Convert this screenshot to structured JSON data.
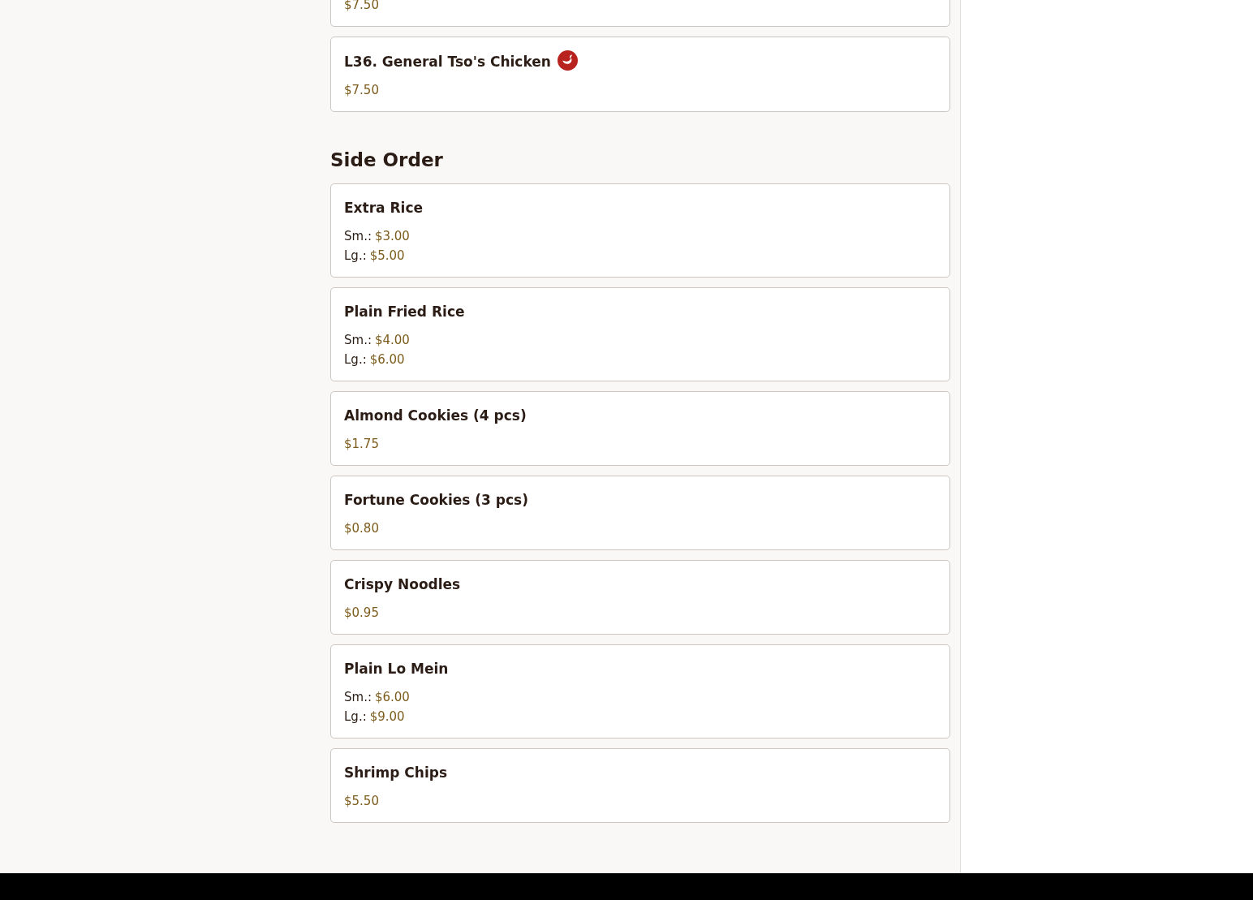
{
  "sections": [
    {
      "items": [
        {
          "kind": "single",
          "price": "$7.50"
        },
        {
          "kind": "single",
          "name": "L36. General Tso's Chicken",
          "price": "$7.50",
          "spicy": true
        }
      ]
    },
    {
      "title": "Side Order",
      "items": [
        {
          "kind": "sized",
          "name": "Extra Rice",
          "sizes": [
            {
              "label": "Sm.:",
              "price": "$3.00"
            },
            {
              "label": "Lg.:",
              "price": "$5.00"
            }
          ],
          "spicy": false
        },
        {
          "kind": "sized",
          "name": "Plain Fried Rice",
          "sizes": [
            {
              "label": "Sm.:",
              "price": "$4.00"
            },
            {
              "label": "Lg.:",
              "price": "$6.00"
            }
          ],
          "spicy": false
        },
        {
          "kind": "single",
          "name": "Almond Cookies (4 pcs)",
          "price": "$1.75",
          "spicy": false
        },
        {
          "kind": "single",
          "name": "Fortune Cookies (3 pcs)",
          "price": "$0.80",
          "spicy": false
        },
        {
          "kind": "single",
          "name": "Crispy Noodles",
          "price": "$0.95",
          "spicy": false
        },
        {
          "kind": "sized",
          "name": "Plain Lo Mein",
          "sizes": [
            {
              "label": "Sm.:",
              "price": "$6.00"
            },
            {
              "label": "Lg.:",
              "price": "$9.00"
            }
          ],
          "spicy": false
        },
        {
          "kind": "single",
          "name": "Shrimp Chips",
          "price": "$5.50",
          "spicy": false
        }
      ]
    }
  ]
}
